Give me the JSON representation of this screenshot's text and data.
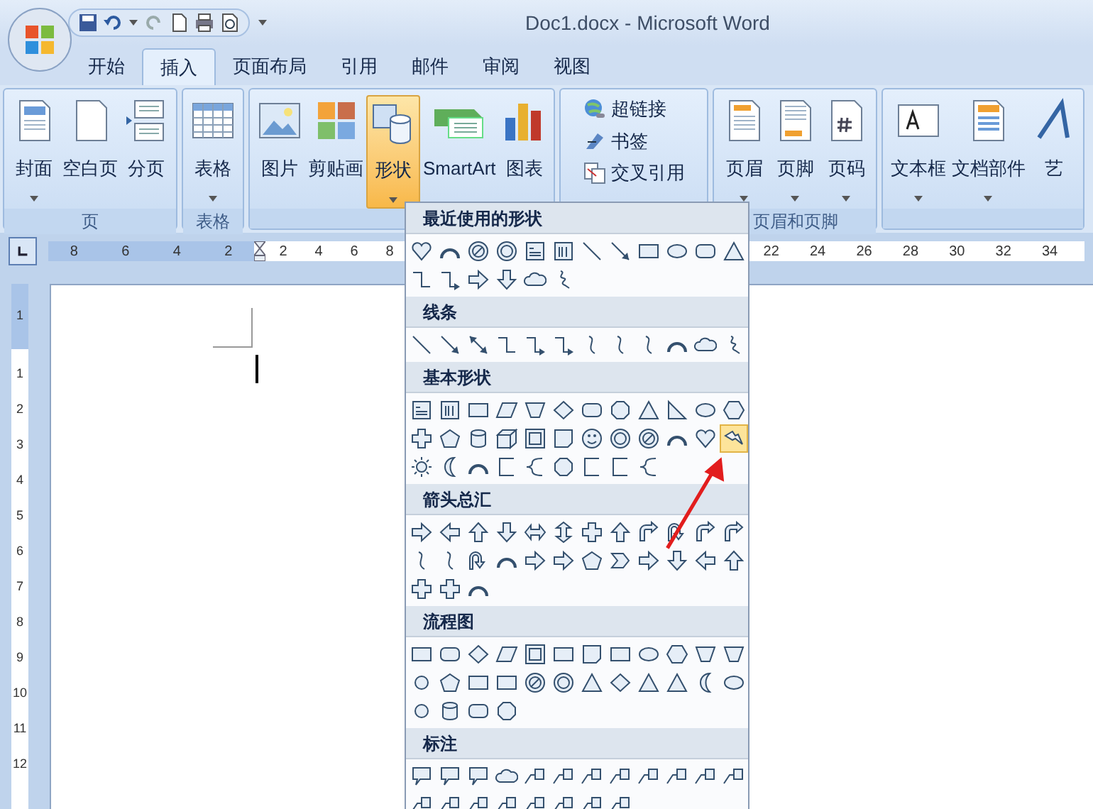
{
  "window": {
    "title": "Doc1.docx - Microsoft Word"
  },
  "tabs": [
    {
      "label": "开始",
      "selected": false
    },
    {
      "label": "插入",
      "selected": true
    },
    {
      "label": "页面布局",
      "selected": false
    },
    {
      "label": "引用",
      "selected": false
    },
    {
      "label": "邮件",
      "selected": false
    },
    {
      "label": "审阅",
      "selected": false
    },
    {
      "label": "视图",
      "selected": false
    }
  ],
  "ribbon": {
    "groups": [
      {
        "label": "页",
        "kind": "large",
        "buttons": [
          {
            "label": "封面",
            "kind": "cover",
            "dropdown": true,
            "selected": false
          },
          {
            "label": "空白页",
            "kind": "blank",
            "dropdown": false,
            "selected": false
          },
          {
            "label": "分页",
            "kind": "pagebreak",
            "dropdown": false,
            "selected": false
          }
        ]
      },
      {
        "label": "表格",
        "kind": "large",
        "buttons": [
          {
            "label": "表格",
            "kind": "table",
            "dropdown": true,
            "selected": false
          }
        ]
      },
      {
        "kind": "large",
        "buttons": [
          {
            "label": "图片",
            "kind": "picture",
            "dropdown": false,
            "selected": false
          },
          {
            "label": "剪贴画",
            "kind": "clipart",
            "dropdown": false,
            "selected": false
          },
          {
            "label": "形状",
            "kind": "shapes",
            "dropdown": true,
            "selected": true
          },
          {
            "label": "SmartArt",
            "kind": "smartart",
            "dropdown": false,
            "selected": false
          },
          {
            "label": "图表",
            "kind": "chart",
            "dropdown": false,
            "selected": false
          }
        ]
      },
      {
        "kind": "compact",
        "buttons": [
          {
            "label": "超链接",
            "kind": "link",
            "dropdown": false,
            "selected": false
          },
          {
            "label": "书签",
            "kind": "bookmark",
            "dropdown": false,
            "selected": false
          },
          {
            "label": "交叉引用",
            "kind": "crossref",
            "dropdown": false,
            "selected": false
          }
        ]
      },
      {
        "label": "页眉和页脚",
        "kind": "large",
        "buttons": [
          {
            "label": "页眉",
            "kind": "header",
            "dropdown": true,
            "selected": false
          },
          {
            "label": "页脚",
            "kind": "footer",
            "dropdown": true,
            "selected": false
          },
          {
            "label": "页码",
            "kind": "pagenumber",
            "dropdown": true,
            "selected": false
          }
        ]
      },
      {
        "kind": "large",
        "buttons": [
          {
            "label": "文本框",
            "kind": "textbox",
            "dropdown": true,
            "selected": false
          },
          {
            "label": "文档部件",
            "kind": "parts",
            "dropdown": true,
            "selected": false
          },
          {
            "label": "艺",
            "kind": "wordart",
            "dropdown": false,
            "selected": false
          }
        ]
      }
    ]
  },
  "ruler": {
    "left_marks": [
      "8",
      "6",
      "4",
      "2",
      "2",
      "4",
      "6",
      "8"
    ],
    "right_marks": [
      "22",
      "24",
      "26",
      "28",
      "30",
      "32",
      "34"
    ],
    "vertical_marks": [
      "1",
      "1",
      "2",
      "3",
      "4",
      "5",
      "6",
      "7",
      "8",
      "9",
      "10",
      "11",
      "12"
    ]
  },
  "shapes_menu": {
    "sections": [
      {
        "title": "最近使用的形状",
        "shapes": [
          {
            "kind": "heart",
            "selected": false
          },
          {
            "kind": "arc",
            "selected": false
          },
          {
            "kind": "nosymbol",
            "selected": false
          },
          {
            "kind": "donut",
            "selected": false
          },
          {
            "kind": "textbox",
            "selected": false
          },
          {
            "kind": "vtextbox",
            "selected": false
          },
          {
            "kind": "line",
            "selected": false
          },
          {
            "kind": "arrowline",
            "selected": false
          },
          {
            "kind": "rect",
            "selected": false
          },
          {
            "kind": "oval",
            "selected": false
          },
          {
            "kind": "roundrect",
            "selected": false
          },
          {
            "kind": "triangle",
            "selected": false
          },
          {
            "kind": "elbow",
            "selected": false
          },
          {
            "kind": "elbowarrow",
            "selected": false
          },
          {
            "kind": "rarrow",
            "selected": false
          },
          {
            "kind": "darrow",
            "selected": false
          },
          {
            "kind": "cloud",
            "selected": false
          },
          {
            "kind": "scribble",
            "selected": false
          }
        ]
      },
      {
        "title": "线条",
        "shapes": [
          {
            "kind": "line",
            "selected": false
          },
          {
            "kind": "arrowline",
            "selected": false
          },
          {
            "kind": "dblarrowline",
            "selected": false
          },
          {
            "kind": "elbow",
            "selected": false
          },
          {
            "kind": "elbowarrow",
            "selected": false
          },
          {
            "kind": "elbowarrow",
            "selected": false
          },
          {
            "kind": "curve",
            "selected": false
          },
          {
            "kind": "curve",
            "selected": false
          },
          {
            "kind": "curve",
            "selected": false
          },
          {
            "kind": "arc",
            "selected": false
          },
          {
            "kind": "cloud",
            "selected": false
          },
          {
            "kind": "scribble",
            "selected": false
          }
        ]
      },
      {
        "title": "基本形状",
        "shapes": [
          {
            "kind": "textbox",
            "selected": false
          },
          {
            "kind": "vtextbox",
            "selected": false
          },
          {
            "kind": "rect",
            "selected": false
          },
          {
            "kind": "parallelogram",
            "selected": false
          },
          {
            "kind": "trapezoid",
            "selected": false
          },
          {
            "kind": "diamond",
            "selected": false
          },
          {
            "kind": "roundrect",
            "selected": false
          },
          {
            "kind": "octagon",
            "selected": false
          },
          {
            "kind": "triangle",
            "selected": false
          },
          {
            "kind": "rtriangle",
            "selected": false
          },
          {
            "kind": "oval",
            "selected": false
          },
          {
            "kind": "hexagon",
            "selected": false
          },
          {
            "kind": "cross",
            "selected": false
          },
          {
            "kind": "pentagon",
            "selected": false
          },
          {
            "kind": "can",
            "selected": false
          },
          {
            "kind": "cube",
            "selected": false
          },
          {
            "kind": "frame",
            "selected": false
          },
          {
            "kind": "folded",
            "selected": false
          },
          {
            "kind": "smiley",
            "selected": false
          },
          {
            "kind": "donut",
            "selected": false
          },
          {
            "kind": "nosymbol",
            "selected": false
          },
          {
            "kind": "arc",
            "selected": false
          },
          {
            "kind": "heart",
            "selected": false
          },
          {
            "kind": "lightning",
            "selected": true
          },
          {
            "kind": "sun",
            "selected": false
          },
          {
            "kind": "moon",
            "selected": false
          },
          {
            "kind": "arc",
            "selected": false
          },
          {
            "kind": "bracket",
            "selected": false
          },
          {
            "kind": "brace",
            "selected": false
          },
          {
            "kind": "octagon",
            "selected": false
          },
          {
            "kind": "bracket",
            "selected": false
          },
          {
            "kind": "bracket",
            "selected": false
          },
          {
            "kind": "brace",
            "selected": false
          }
        ]
      },
      {
        "title": "箭头总汇",
        "shapes": [
          {
            "kind": "rarrow",
            "selected": false
          },
          {
            "kind": "larrow",
            "selected": false
          },
          {
            "kind": "uarrow",
            "selected": false
          },
          {
            "kind": "darrow",
            "selected": false
          },
          {
            "kind": "lrarrow",
            "selected": false
          },
          {
            "kind": "udarrow",
            "selected": false
          },
          {
            "kind": "cross",
            "selected": false
          },
          {
            "kind": "uarrow",
            "selected": false
          },
          {
            "kind": "bentarrow",
            "selected": false
          },
          {
            "kind": "uturn",
            "selected": false
          },
          {
            "kind": "bentarrow",
            "selected": false
          },
          {
            "kind": "bentarrow",
            "selected": false
          },
          {
            "kind": "curve",
            "selected": false
          },
          {
            "kind": "curve",
            "selected": false
          },
          {
            "kind": "uturn",
            "selected": false
          },
          {
            "kind": "arc",
            "selected": false
          },
          {
            "kind": "rarrow",
            "selected": false
          },
          {
            "kind": "rarrow",
            "selected": false
          },
          {
            "kind": "pentagon",
            "selected": false
          },
          {
            "kind": "chevron",
            "selected": false
          },
          {
            "kind": "rarrow",
            "selected": false
          },
          {
            "kind": "darrow",
            "selected": false
          },
          {
            "kind": "larrow",
            "selected": false
          },
          {
            "kind": "uarrow",
            "selected": false
          },
          {
            "kind": "cross",
            "selected": false
          },
          {
            "kind": "cross",
            "selected": false
          },
          {
            "kind": "arc",
            "selected": false
          }
        ]
      },
      {
        "title": "流程图",
        "shapes": [
          {
            "kind": "rect",
            "selected": false
          },
          {
            "kind": "roundrect",
            "selected": false
          },
          {
            "kind": "diamond",
            "selected": false
          },
          {
            "kind": "parallelogram",
            "selected": false
          },
          {
            "kind": "frame",
            "selected": false
          },
          {
            "kind": "rect",
            "selected": false
          },
          {
            "kind": "folded",
            "selected": false
          },
          {
            "kind": "rect",
            "selected": false
          },
          {
            "kind": "oval",
            "selected": false
          },
          {
            "kind": "hexagon",
            "selected": false
          },
          {
            "kind": "trapezoid",
            "selected": false
          },
          {
            "kind": "trapezoid",
            "selected": false
          },
          {
            "kind": "circle",
            "selected": false
          },
          {
            "kind": "pentagon",
            "selected": false
          },
          {
            "kind": "rect",
            "selected": false
          },
          {
            "kind": "rect",
            "selected": false
          },
          {
            "kind": "nosymbol",
            "selected": false
          },
          {
            "kind": "donut",
            "selected": false
          },
          {
            "kind": "triangle",
            "selected": false
          },
          {
            "kind": "diamond",
            "selected": false
          },
          {
            "kind": "triangle",
            "selected": false
          },
          {
            "kind": "triangle",
            "selected": false
          },
          {
            "kind": "moon",
            "selected": false
          },
          {
            "kind": "oval",
            "selected": false
          },
          {
            "kind": "circle",
            "selected": false
          },
          {
            "kind": "can",
            "selected": false
          },
          {
            "kind": "roundrect",
            "selected": false
          },
          {
            "kind": "octagon",
            "selected": false
          }
        ]
      },
      {
        "title": "标注",
        "shapes": [
          {
            "kind": "callout",
            "selected": false
          },
          {
            "kind": "callout",
            "selected": false
          },
          {
            "kind": "callout",
            "selected": false
          },
          {
            "kind": "cloud",
            "selected": false
          },
          {
            "kind": "linecallout",
            "selected": false
          },
          {
            "kind": "linecallout",
            "selected": false
          },
          {
            "kind": "linecallout",
            "selected": false
          },
          {
            "kind": "linecallout",
            "selected": false
          },
          {
            "kind": "linecallout",
            "selected": false
          },
          {
            "kind": "linecallout",
            "selected": false
          },
          {
            "kind": "linecallout",
            "selected": false
          },
          {
            "kind": "linecallout",
            "selected": false
          },
          {
            "kind": "linecallout",
            "selected": false
          },
          {
            "kind": "linecallout",
            "selected": false
          },
          {
            "kind": "linecallout",
            "selected": false
          },
          {
            "kind": "linecallout",
            "selected": false
          },
          {
            "kind": "linecallout",
            "selected": false
          },
          {
            "kind": "linecallout",
            "selected": false
          },
          {
            "kind": "linecallout",
            "selected": false
          },
          {
            "kind": "linecallout",
            "selected": false
          }
        ]
      }
    ]
  }
}
